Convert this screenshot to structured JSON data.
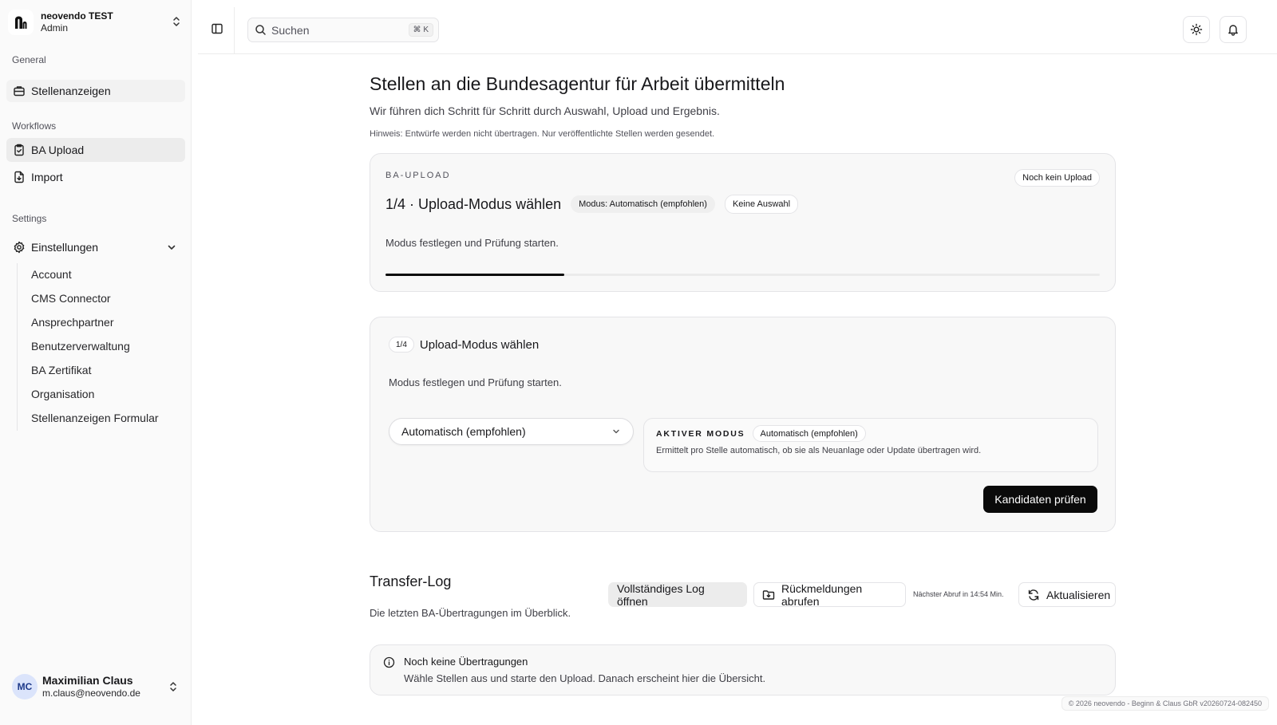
{
  "sidebar": {
    "org": {
      "name": "neovendo TEST",
      "role": "Admin",
      "logo_icon": "neovendo-logo"
    },
    "groups": {
      "general": "General",
      "workflows": "Workflows",
      "settings": "Settings"
    },
    "items": {
      "stellenanzeigen": "Stellenanzeigen",
      "ba_upload": "BA Upload",
      "import": "Import",
      "einstellungen": "Einstellungen"
    },
    "settings_sub": [
      "Account",
      "CMS Connector",
      "Ansprechpartner",
      "Benutzerverwaltung",
      "BA Zertifikat",
      "Organisation",
      "Stellenanzeigen Formular"
    ],
    "user": {
      "initials": "MC",
      "name": "Maximilian Claus",
      "email": "m.claus@neovendo.de"
    }
  },
  "header": {
    "search_placeholder": "Suchen",
    "search_shortcut": "⌘ K"
  },
  "main": {
    "title": "Stellen an die Bundesagentur für Arbeit übermitteln",
    "subtitle": "Wir führen dich Schritt für Schritt durch Auswahl, Upload und Ergebnis.",
    "hint": "Hinweis: Entwürfe werden nicht übertragen. Nur veröffentlichte Stellen werden gesendet.",
    "status_card": {
      "eyebrow": "BA-UPLOAD",
      "status_badge": "Noch kein Upload",
      "step_title": "1/4 · Upload-Modus wählen",
      "mode_pill": "Modus: Automatisch (empfohlen)",
      "selection_pill": "Keine Auswahl",
      "description": "Modus festlegen und Prüfung starten.",
      "progress": 0.25
    },
    "step_card": {
      "step_badge": "1/4",
      "title": "Upload-Modus wählen",
      "description": "Modus festlegen und Prüfung starten.",
      "select_value": "Automatisch (empfohlen)",
      "active_mode_label": "AKTIVER MODUS",
      "active_mode_value": "Automatisch (empfohlen)",
      "active_mode_desc": "Ermittelt pro Stelle automatisch, ob sie als Neuanlage oder Update übertragen wird.",
      "primary_button": "Kandidaten prüfen"
    },
    "transfer_log": {
      "title": "Transfer-Log",
      "subtitle": "Die letzten BA-Übertragungen im Überblick.",
      "open_log_button": "Vollständiges Log öffnen",
      "fetch_button": "Rückmeldungen abrufen",
      "next_fetch": "Nächster Abruf in 14:54 Min.",
      "refresh_button": "Aktualisieren",
      "empty_title": "Noch keine Übertragungen",
      "empty_desc": "Wähle Stellen aus und starte den Upload. Danach erscheint hier die Übersicht."
    }
  },
  "footer": "© 2026 neovendo - Beginn & Claus GbR v20260724-082450"
}
